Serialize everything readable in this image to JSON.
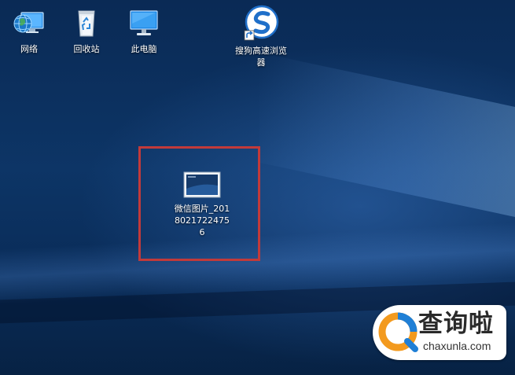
{
  "desktop": {
    "icons": [
      {
        "id": "network",
        "label": "网络",
        "icon": "network-globe-icon"
      },
      {
        "id": "recycle",
        "label": "回收站",
        "icon": "recycle-bin-icon"
      },
      {
        "id": "pc",
        "label": "此电脑",
        "icon": "computer-monitor-icon"
      },
      {
        "id": "sogou",
        "label": "搜狗高速浏览器",
        "icon": "sogou-browser-icon"
      },
      {
        "id": "image",
        "label": "微信图片_20180217224756",
        "icon": "image-file-icon"
      }
    ]
  },
  "watermark": {
    "title": "查询啦",
    "url": "chaxunla.com",
    "colors": {
      "accent_orange": "#f39a1e",
      "accent_blue": "#1f7fd6"
    }
  },
  "colors": {
    "highlight_border": "#c23a3a",
    "wallpaper_base": "#0b2d57"
  }
}
